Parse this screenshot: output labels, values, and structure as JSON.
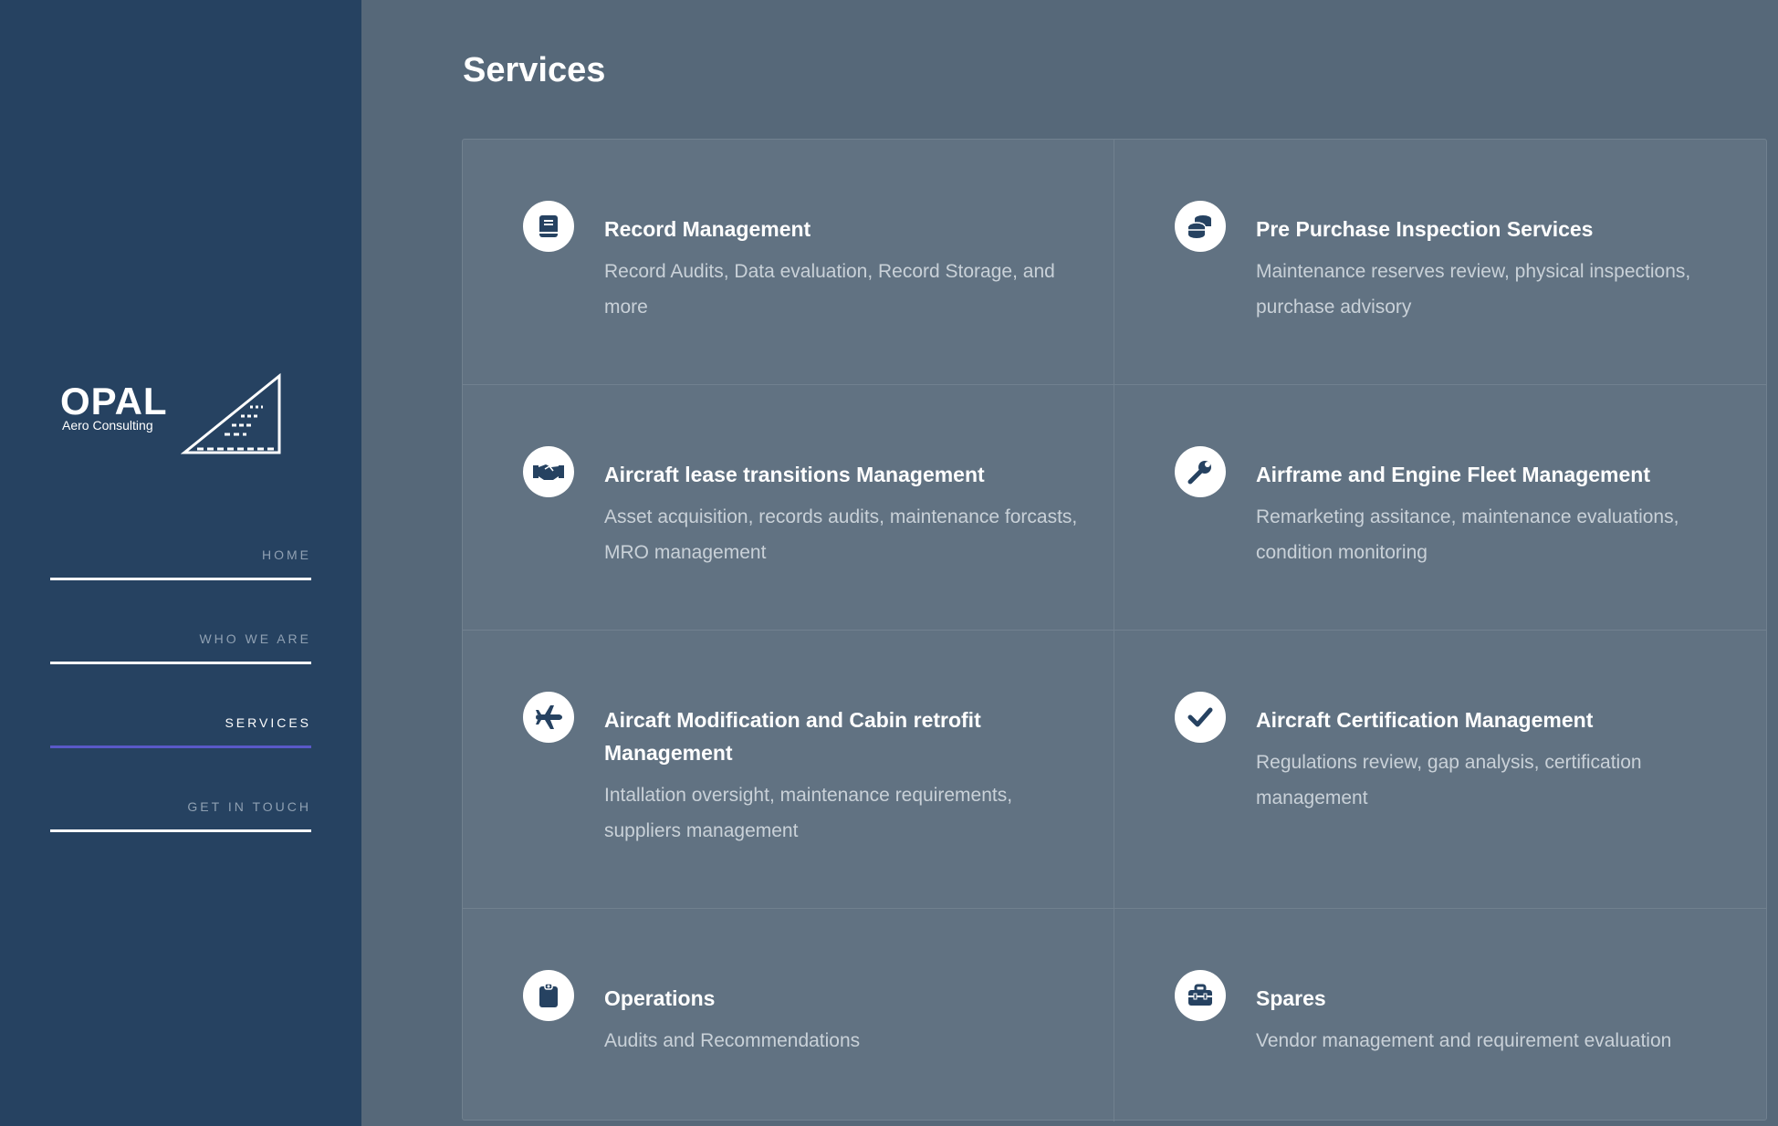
{
  "brand": {
    "name": "OPAL",
    "tagline": "Aero Consulting"
  },
  "nav": {
    "items": [
      {
        "label": "HOME",
        "active": false
      },
      {
        "label": "WHO WE ARE",
        "active": false
      },
      {
        "label": "SERVICES",
        "active": true
      },
      {
        "label": "GET IN TOUCH",
        "active": false
      }
    ]
  },
  "page": {
    "title": "Services"
  },
  "services": [
    {
      "icon": "book-icon",
      "title": "Record Management",
      "description": "Record Audits, Data evaluation, Record Storage, and more"
    },
    {
      "icon": "coins-icon",
      "title": "Pre Purchase Inspection Services",
      "description": "Maintenance reserves review, physical inspections, purchase advisory"
    },
    {
      "icon": "handshake-icon",
      "title": "Aircraft lease transitions Management",
      "description": "Asset acquisition, records audits, maintenance forcasts, MRO management"
    },
    {
      "icon": "wrench-icon",
      "title": "Airframe and Engine Fleet Management",
      "description": "Remarketing assitance, maintenance evaluations, condition monitoring"
    },
    {
      "icon": "plane-icon",
      "title": "Aircaft Modification and Cabin retrofit Management",
      "description": "Intallation oversight, maintenance requirements, suppliers management"
    },
    {
      "icon": "check-icon",
      "title": "Aircraft Certification Management",
      "description": "Regulations review, gap analysis, certification management"
    },
    {
      "icon": "clipboard-icon",
      "title": "Operations",
      "description": "Audits and Recommendations"
    },
    {
      "icon": "toolbox-icon",
      "title": "Spares",
      "description": "Vendor management and requirement evaluation"
    }
  ],
  "colors": {
    "sidebar": "#264261",
    "background": "#566879",
    "card": "#617282",
    "accent": "#5a59c8",
    "icon": "#264261"
  }
}
